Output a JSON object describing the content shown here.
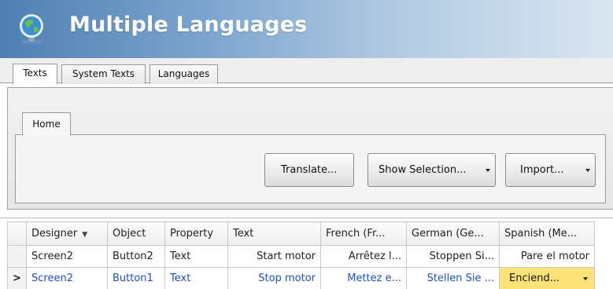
{
  "window": {
    "title": "Multiple Languages"
  },
  "tabs": [
    {
      "label": "Texts",
      "active": true
    },
    {
      "label": "System Texts",
      "active": false
    },
    {
      "label": "Languages",
      "active": false
    }
  ],
  "ribbon": {
    "home_tab": "Home",
    "buttons": {
      "translate": "Translate...",
      "show_selection": "Show Selection...",
      "import": "Import..."
    }
  },
  "grid": {
    "columns": [
      "Designer",
      "Object",
      "Property",
      "Text",
      "French (Fr...",
      "German (Ge...",
      "Spanish (Me..."
    ],
    "rows": [
      {
        "designer": "Screen2",
        "object": "Button2",
        "property": "Text",
        "text": "Start motor",
        "french": "Arrêtez l...",
        "german": "Stoppen Si...",
        "spanish": "Pare el motor"
      },
      {
        "designer": "Screen2",
        "object": "Button1",
        "property": "Text",
        "text": "Stop motor",
        "french": "Mettez e...",
        "german": "Stellen Sie ...",
        "spanish": "Enciend..."
      }
    ],
    "selected_row_indicator": ">"
  },
  "colors": {
    "title_gradient_start": "#4f7fb3",
    "selected_text": "#1f4fbf",
    "editing_cell": "#fde27a"
  },
  "icons": {
    "app": "globe-icon",
    "sort": "sort-down-icon",
    "dropdown": "chevron-down-icon",
    "row_pointer": "row-pointer-icon"
  }
}
